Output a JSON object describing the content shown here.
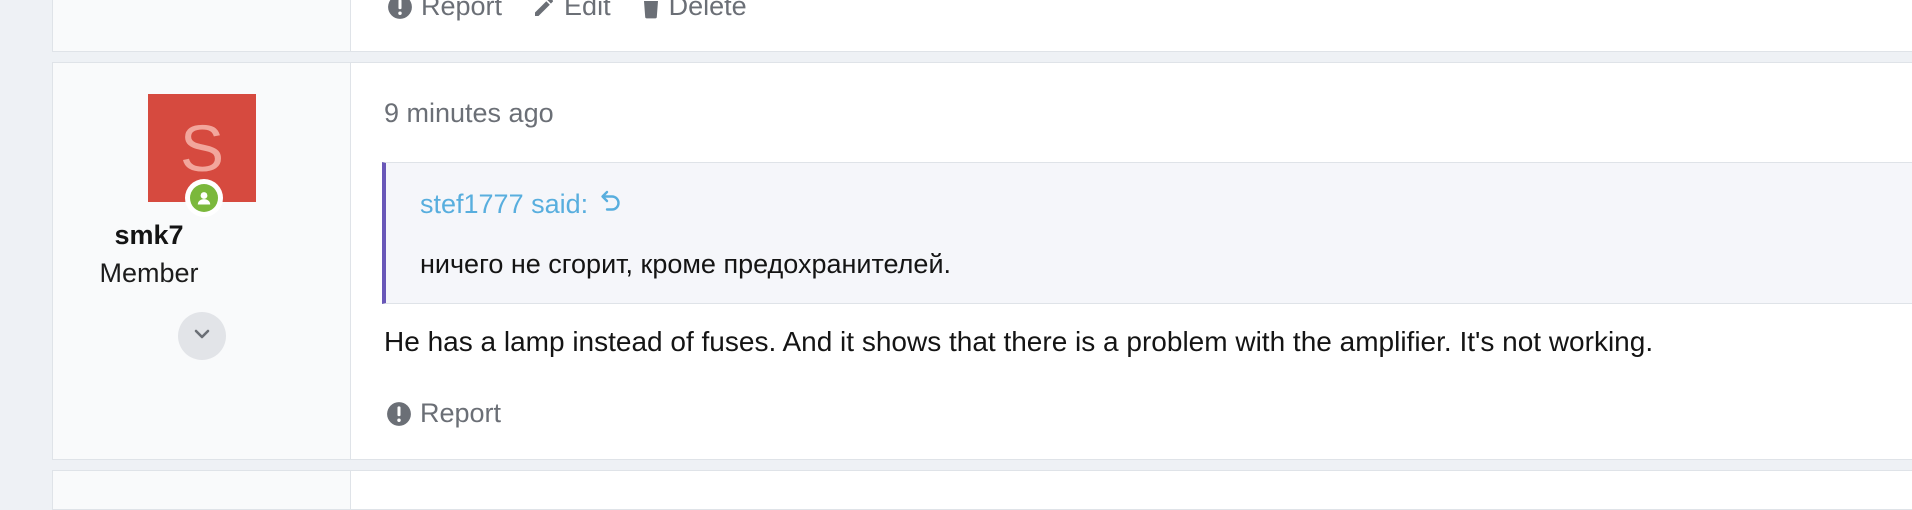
{
  "previous_post": {
    "actions": {
      "report": "Report",
      "edit": "Edit",
      "delete": "Delete"
    }
  },
  "post": {
    "author": {
      "avatar_letter": "S",
      "avatar_color": "#d64a3f",
      "online_status_color": "#7bb83c",
      "username": "smk7",
      "role": "Member"
    },
    "timestamp": "9 minutes ago",
    "quote": {
      "author_text": "stef1777 said:",
      "text": "ничего не сгорит, кроме предохранителей.",
      "accent_color": "#6957b8",
      "link_color": "#58aede"
    },
    "body": "He has a lamp instead of fuses. And it shows that there is a problem with the amplifier. It's not working.",
    "actions": {
      "report": "Report"
    }
  }
}
